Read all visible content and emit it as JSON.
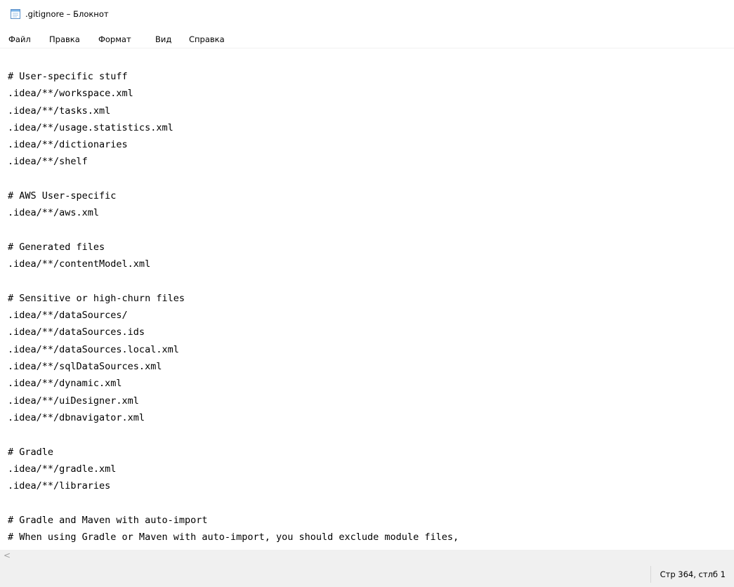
{
  "window": {
    "title": ".gitignore – Блокнот",
    "icon": "notepad-icon"
  },
  "menu": {
    "items": [
      "Файл",
      "Правка",
      "Формат",
      "Вид",
      "Справка"
    ]
  },
  "editor": {
    "text": "# User-specific stuff\n.idea/**/workspace.xml\n.idea/**/tasks.xml\n.idea/**/usage.statistics.xml\n.idea/**/dictionaries\n.idea/**/shelf\n\n# AWS User-specific\n.idea/**/aws.xml\n\n# Generated files\n.idea/**/contentModel.xml\n\n# Sensitive or high-churn files\n.idea/**/dataSources/\n.idea/**/dataSources.ids\n.idea/**/dataSources.local.xml\n.idea/**/sqlDataSources.xml\n.idea/**/dynamic.xml\n.idea/**/uiDesigner.xml\n.idea/**/dbnavigator.xml\n\n# Gradle\n.idea/**/gradle.xml\n.idea/**/libraries\n\n# Gradle and Maven with auto-import\n# When using Gradle or Maven with auto-import, you should exclude module files,"
  },
  "scrollbar": {
    "left_arrow": "<"
  },
  "status_bar": {
    "cursor_position": "Стр 364, стлб 1"
  },
  "colors": {
    "chrome_gray": "#f0f0f0",
    "text": "#000000",
    "background": "#ffffff"
  }
}
